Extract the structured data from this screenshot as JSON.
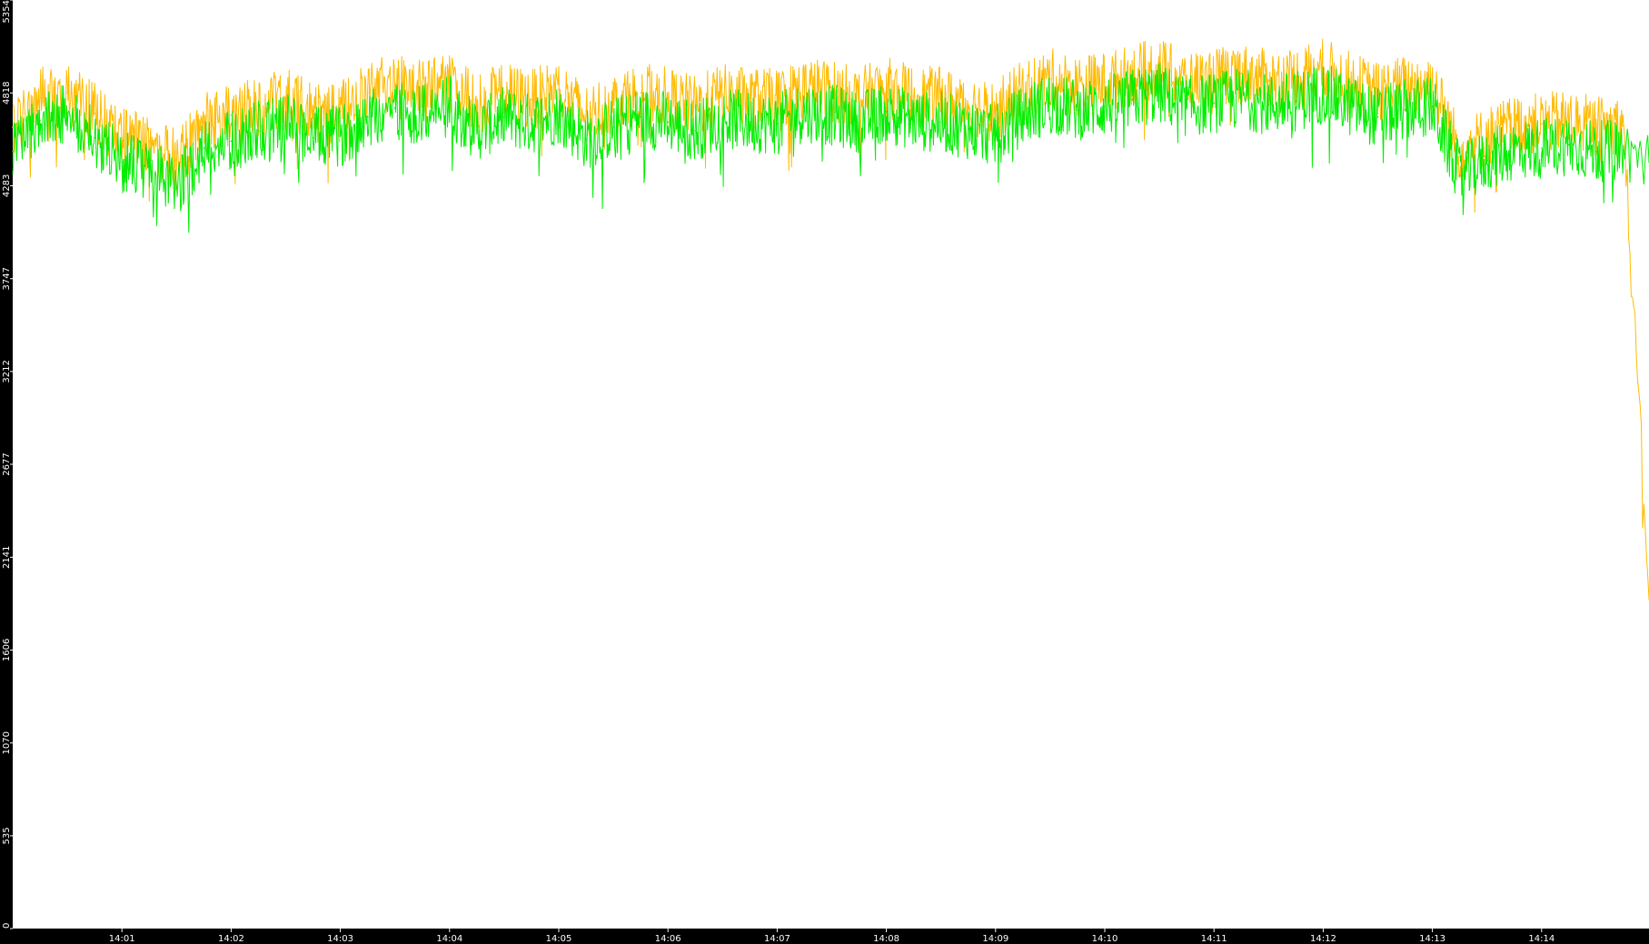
{
  "chart_data": {
    "type": "line",
    "title": "",
    "xlabel": "",
    "ylabel": "",
    "grid": false,
    "legend": "none",
    "background": "#ffffff",
    "frame_color": "#000000",
    "ylim": [
      0,
      5354
    ],
    "y_ticks": [
      0,
      535,
      1070,
      1606,
      2141,
      2677,
      3212,
      3747,
      4283,
      4818,
      5354
    ],
    "y_tick_labels": [
      "0",
      "535",
      "1070",
      "1606",
      "2141",
      "2677",
      "3212",
      "3747",
      "4283",
      "4818",
      "5354"
    ],
    "xlim": [
      "14:00:00",
      "14:14:59"
    ],
    "x_ticks": [
      "14:01",
      "14:02",
      "14:03",
      "14:04",
      "14:05",
      "14:06",
      "14:07",
      "14:08",
      "14:09",
      "14:10",
      "14:11",
      "14:12",
      "14:13",
      "14:14"
    ],
    "series": [
      {
        "color": "#ffbb00",
        "x": [
          "14:00:00",
          "14:00:15",
          "14:00:30",
          "14:00:45",
          "14:01:00",
          "14:01:15",
          "14:01:30",
          "14:01:45",
          "14:02:00",
          "14:02:15",
          "14:02:30",
          "14:02:45",
          "14:03:00",
          "14:03:15",
          "14:03:30",
          "14:03:45",
          "14:04:00",
          "14:04:15",
          "14:04:30",
          "14:04:45",
          "14:05:00",
          "14:05:15",
          "14:05:30",
          "14:05:45",
          "14:06:00",
          "14:06:15",
          "14:06:30",
          "14:06:45",
          "14:07:00",
          "14:07:15",
          "14:07:30",
          "14:07:45",
          "14:08:00",
          "14:08:15",
          "14:08:30",
          "14:08:45",
          "14:09:00",
          "14:09:15",
          "14:09:30",
          "14:09:45",
          "14:10:00",
          "14:10:15",
          "14:10:30",
          "14:10:45",
          "14:11:00",
          "14:11:15",
          "14:11:30",
          "14:11:45",
          "14:12:00",
          "14:12:15",
          "14:12:30",
          "14:12:45",
          "14:13:00",
          "14:13:15",
          "14:13:30",
          "14:13:45",
          "14:14:00",
          "14:14:15",
          "14:14:30",
          "14:14:45",
          "14:14:59"
        ],
        "values": [
          4620,
          4790,
          4820,
          4700,
          4560,
          4540,
          4430,
          4650,
          4690,
          4740,
          4790,
          4700,
          4710,
          4820,
          4870,
          4830,
          4880,
          4750,
          4820,
          4780,
          4840,
          4690,
          4760,
          4820,
          4790,
          4740,
          4810,
          4790,
          4780,
          4850,
          4830,
          4790,
          4850,
          4800,
          4790,
          4750,
          4710,
          4830,
          4900,
          4860,
          4880,
          4920,
          4960,
          4880,
          4900,
          4930,
          4890,
          4910,
          4960,
          4880,
          4820,
          4860,
          4880,
          4480,
          4570,
          4630,
          4640,
          4660,
          4620,
          4630,
          1900
        ]
      },
      {
        "color": "#00ee00",
        "x": [
          "14:00:00",
          "14:00:15",
          "14:00:30",
          "14:00:45",
          "14:01:00",
          "14:01:15",
          "14:01:30",
          "14:01:45",
          "14:02:00",
          "14:02:15",
          "14:02:30",
          "14:02:45",
          "14:03:00",
          "14:03:15",
          "14:03:30",
          "14:03:45",
          "14:04:00",
          "14:04:15",
          "14:04:30",
          "14:04:45",
          "14:05:00",
          "14:05:15",
          "14:05:30",
          "14:05:45",
          "14:06:00",
          "14:06:15",
          "14:06:30",
          "14:06:45",
          "14:07:00",
          "14:07:15",
          "14:07:30",
          "14:07:45",
          "14:08:00",
          "14:08:15",
          "14:08:30",
          "14:08:45",
          "14:09:00",
          "14:09:15",
          "14:09:30",
          "14:09:45",
          "14:10:00",
          "14:10:15",
          "14:10:30",
          "14:10:45",
          "14:11:00",
          "14:11:15",
          "14:11:30",
          "14:11:45",
          "14:12:00",
          "14:12:15",
          "14:12:30",
          "14:12:45",
          "14:13:00",
          "14:13:15",
          "14:13:30",
          "14:13:45",
          "14:14:00",
          "14:14:15",
          "14:14:30",
          "14:14:45",
          "14:14:59"
        ],
        "values": [
          4480,
          4660,
          4700,
          4560,
          4420,
          4380,
          4270,
          4500,
          4540,
          4600,
          4650,
          4560,
          4570,
          4680,
          4730,
          4690,
          4740,
          4600,
          4680,
          4640,
          4700,
          4550,
          4620,
          4680,
          4650,
          4600,
          4670,
          4650,
          4640,
          4710,
          4690,
          4650,
          4710,
          4660,
          4650,
          4610,
          4570,
          4690,
          4760,
          4720,
          4740,
          4780,
          4820,
          4740,
          4760,
          4790,
          4750,
          4770,
          4820,
          4740,
          4680,
          4720,
          4740,
          4340,
          4430,
          4490,
          4500,
          4520,
          4480,
          4490,
          4420
        ]
      }
    ]
  }
}
